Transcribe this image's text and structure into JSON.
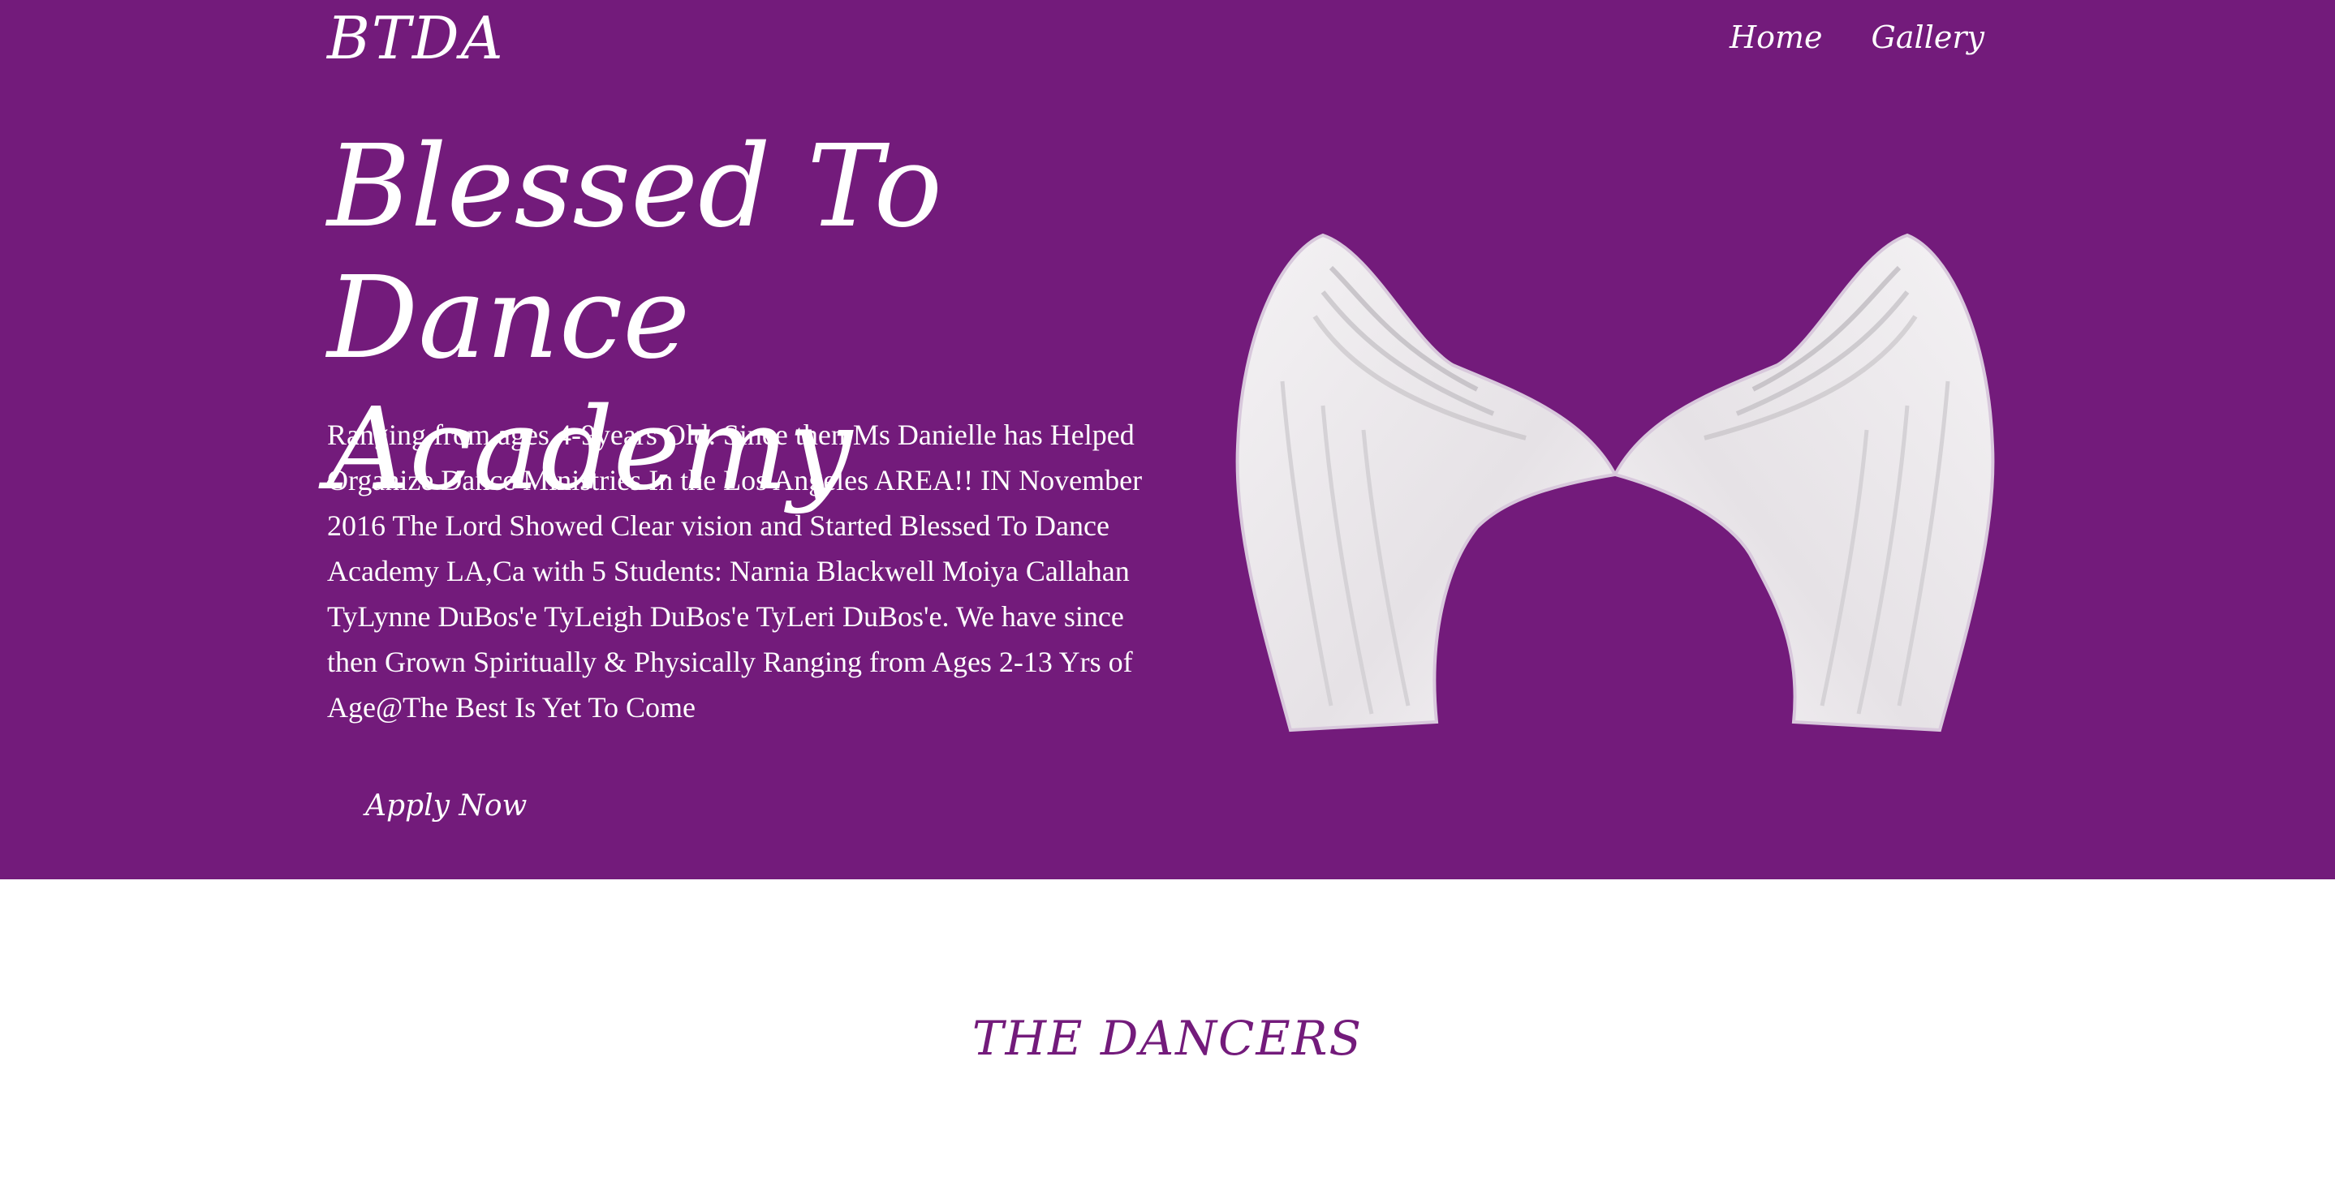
{
  "header": {
    "brand": "BTDA",
    "nav": [
      {
        "label": "Home"
      },
      {
        "label": "Gallery"
      }
    ]
  },
  "hero": {
    "title": "Blessed To Dance Academy",
    "description": "Ranging from ages 4-9years Old. Since then Ms Danielle has Helped Organize Dance Ministries In the Los Angeles AREA!! IN November 2016 The Lord Showed Clear vision and Started Blessed To Dance Academy LA,Ca with 5 Students: Narnia Blackwell Moiya Callahan TyLynne DuBos'e TyLeigh DuBos'e TyLeri DuBos'e. We have since then Grown Spiritually & Physically Ranging from Ages 2-13 Yrs of Age@The Best Is Yet To Come",
    "cta_label": "Apply Now",
    "image_icon": "angel-wings"
  },
  "section": {
    "heading": "THE DANCERS"
  },
  "colors": {
    "primary": "#731b7b",
    "text_on_primary": "#ffffff",
    "background": "#ffffff"
  }
}
